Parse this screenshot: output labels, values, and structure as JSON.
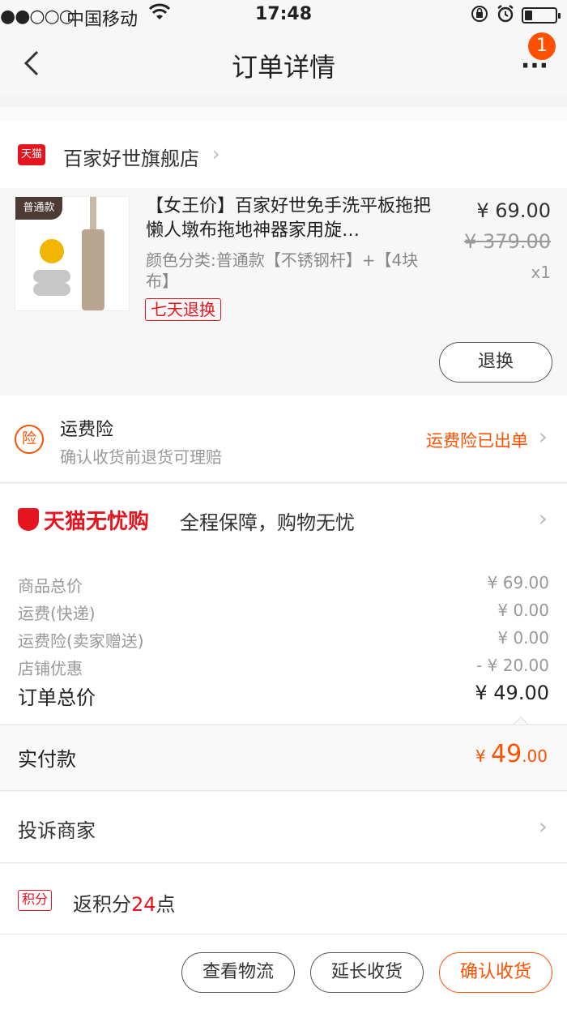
{
  "status_bar": {
    "signal": "●●○○○",
    "carrier": "中国移动",
    "time": "17:48",
    "battery_level": 0.25
  },
  "nav": {
    "title": "订单详情",
    "badge_count": "1"
  },
  "store": {
    "logo_text": "天猫",
    "name": "百家好世旗舰店"
  },
  "product": {
    "thumb_tag": "普通款",
    "title": "【女王价】百家好世免手洗平板拖把懒人墩布拖地神器家用旋…",
    "spec": "颜色分类:普通款【不锈钢杆】+【4块布】",
    "return_tag": "七天退换",
    "price": "¥ 69.00",
    "original_price": "¥ 379.00",
    "quantity": "x1",
    "refund_button": "退换"
  },
  "insurance": {
    "icon_char": "险",
    "title": "运费险",
    "subtitle": "确认收货前退货可理赔",
    "status": "运费险已出单"
  },
  "worry_free": {
    "logo_text": "天猫无忧购",
    "description": "全程保障，购物无忧"
  },
  "price_details": [
    {
      "label": "商品总价",
      "value": "¥ 69.00"
    },
    {
      "label": "运费(快递)",
      "value": "¥ 0.00"
    },
    {
      "label": "运费险(卖家赠送)",
      "value": "¥ 0.00"
    },
    {
      "label": "店铺优惠",
      "value": "- ¥ 20.00"
    },
    {
      "label": "订单总价",
      "value": "¥ 49.00"
    }
  ],
  "paid": {
    "label": "实付款",
    "currency": "¥ ",
    "integer": "49",
    "decimal": ".00"
  },
  "complain": {
    "label": "投诉商家"
  },
  "points": {
    "tag": "积分",
    "prefix": "返积分",
    "amount": "24",
    "suffix": "点"
  },
  "actions": {
    "logistics": "查看物流",
    "extend": "延长收货",
    "confirm": "确认收货"
  },
  "colors": {
    "accent": "#ff5000",
    "tmall_red": "#e4151f"
  }
}
